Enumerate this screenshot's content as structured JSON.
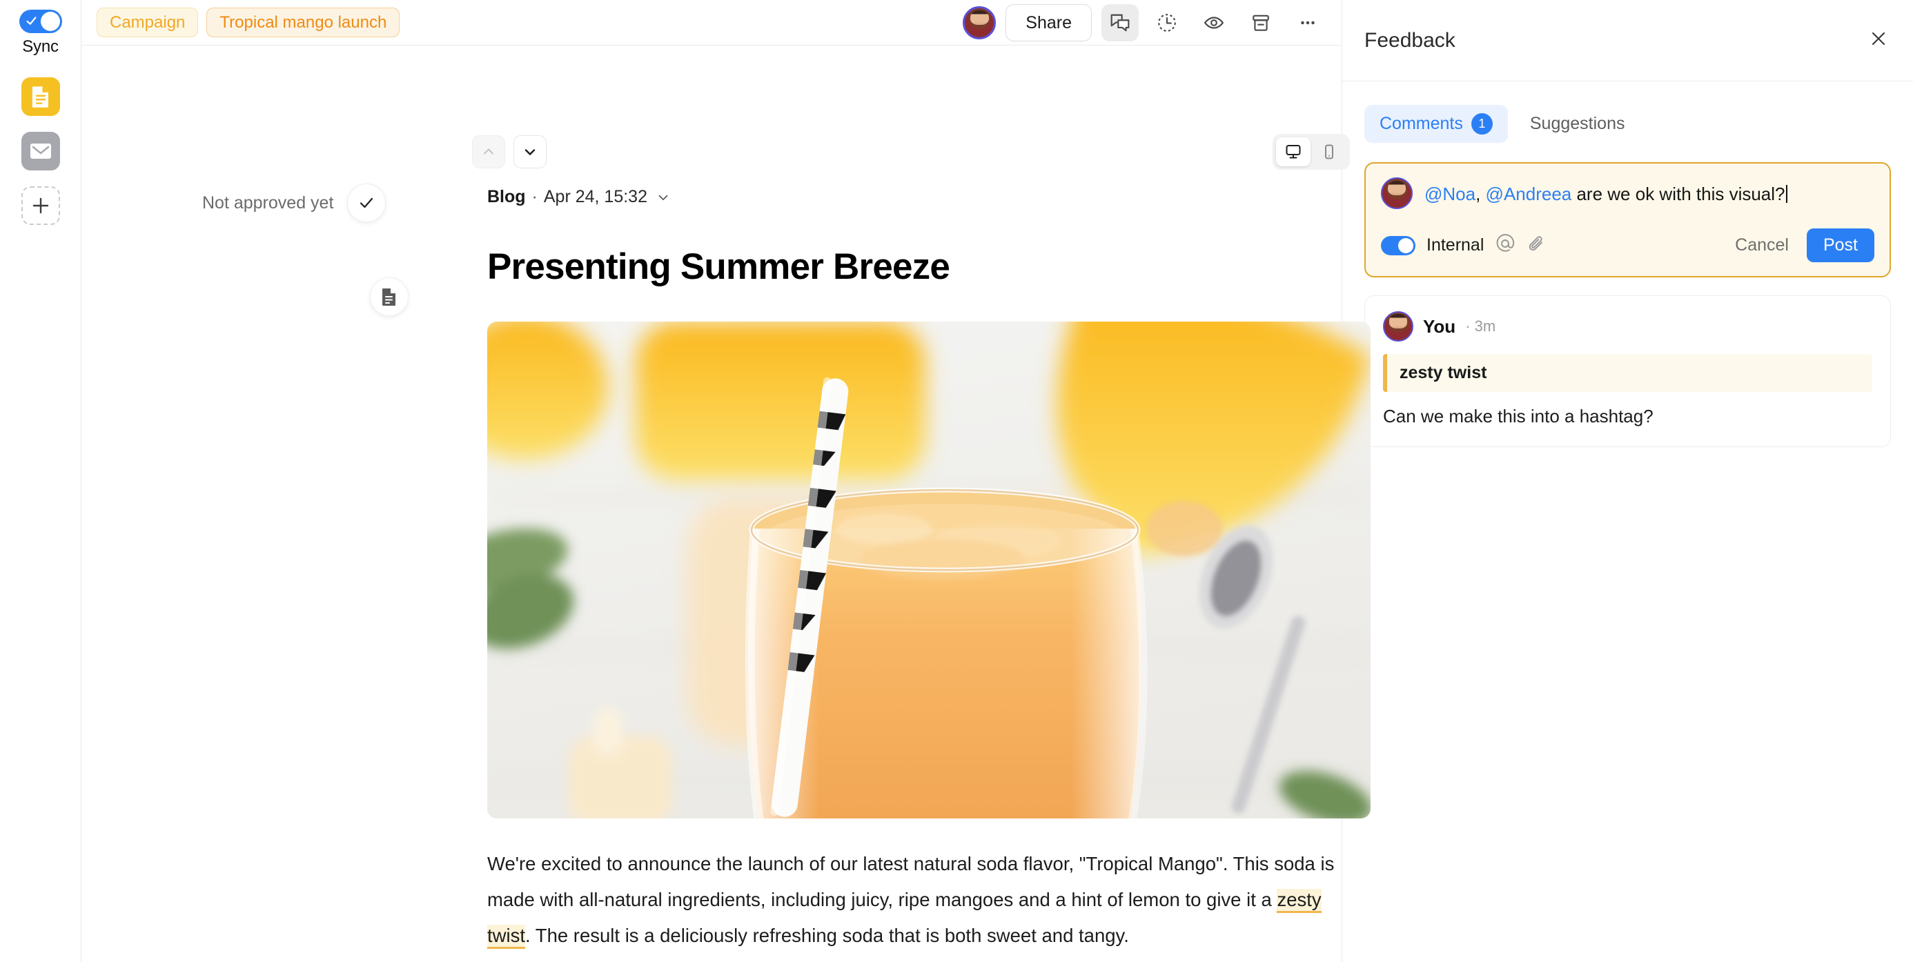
{
  "rail": {
    "sync": {
      "label": "Sync",
      "state": "on",
      "icon": "check-toggle-icon"
    },
    "items": [
      {
        "name": "document",
        "icon": "document-icon",
        "color": "#f5c022",
        "active": true
      },
      {
        "name": "email",
        "icon": "envelope-icon",
        "color": "#a6a8ad",
        "active": false
      },
      {
        "name": "add",
        "icon": "plus-icon",
        "color": "#c9cacc",
        "active": false
      }
    ]
  },
  "topbar": {
    "chips": [
      {
        "label": "Campaign",
        "color": "#f0a825"
      },
      {
        "label": "Tropical mango launch",
        "color": "#ef8b14"
      }
    ],
    "avatar_name": "user-avatar",
    "share_label": "Share",
    "icons": [
      {
        "name": "comments-icon",
        "active": true
      },
      {
        "name": "history-clock-icon",
        "active": false
      },
      {
        "name": "eye-icon",
        "active": false
      },
      {
        "name": "archive-icon",
        "active": false
      },
      {
        "name": "more-options-icon",
        "active": false
      }
    ]
  },
  "document": {
    "nav": {
      "prev": "chevron-up-icon",
      "next": "chevron-down-icon",
      "prev_disabled": true
    },
    "device_toggle": {
      "desktop": "monitor-icon",
      "mobile": "phone-icon",
      "selected": "desktop"
    },
    "approval_status": "Not approved yet",
    "approve_icon": "check-icon",
    "doc_icon": "document-page-icon",
    "meta": {
      "type": "Blog",
      "separator": "·",
      "date": "Apr 24, 15:32",
      "chevron": "chevron-down-icon"
    },
    "title": "Presenting Summer Breeze",
    "hero_alt": "mango-smoothie-photo",
    "paragraph": {
      "before": "We're excited to announce the launch of our latest natural soda flavor, \"Tropical Mango\". This soda is made with all-natural ingredients, including juicy, ripe mangoes and a hint of lemon to give it a ",
      "highlight": "zesty twist",
      "after": ". The result is a deliciously refreshing soda that is both sweet and tangy."
    }
  },
  "panel": {
    "title": "Feedback",
    "close_icon": "close-icon",
    "tabs": [
      {
        "label": "Comments",
        "count": "1",
        "active": true
      },
      {
        "label": "Suggestions",
        "count": "",
        "active": false
      }
    ],
    "composer": {
      "mention_1": "@Noa",
      "mention_sep": ", ",
      "mention_2": "@Andreea",
      "text": " are we ok with this visual?",
      "internal_label": "Internal",
      "internal_state": "on",
      "mention_icon": "at-mention-icon",
      "attach_icon": "paperclip-icon",
      "cancel_label": "Cancel",
      "post_label": "Post"
    },
    "comments": [
      {
        "author": "You",
        "time_separator": "·",
        "time": "3m",
        "quote": "zesty twist",
        "body": "Can we make this into a hashtag?"
      }
    ]
  },
  "colors": {
    "accent_blue": "#2b7ff4",
    "accent_yellow": "#f5c022",
    "chip_orange": "#ef8b14",
    "composer_border": "#e0a62a",
    "composer_bg": "#fdf8e9"
  }
}
